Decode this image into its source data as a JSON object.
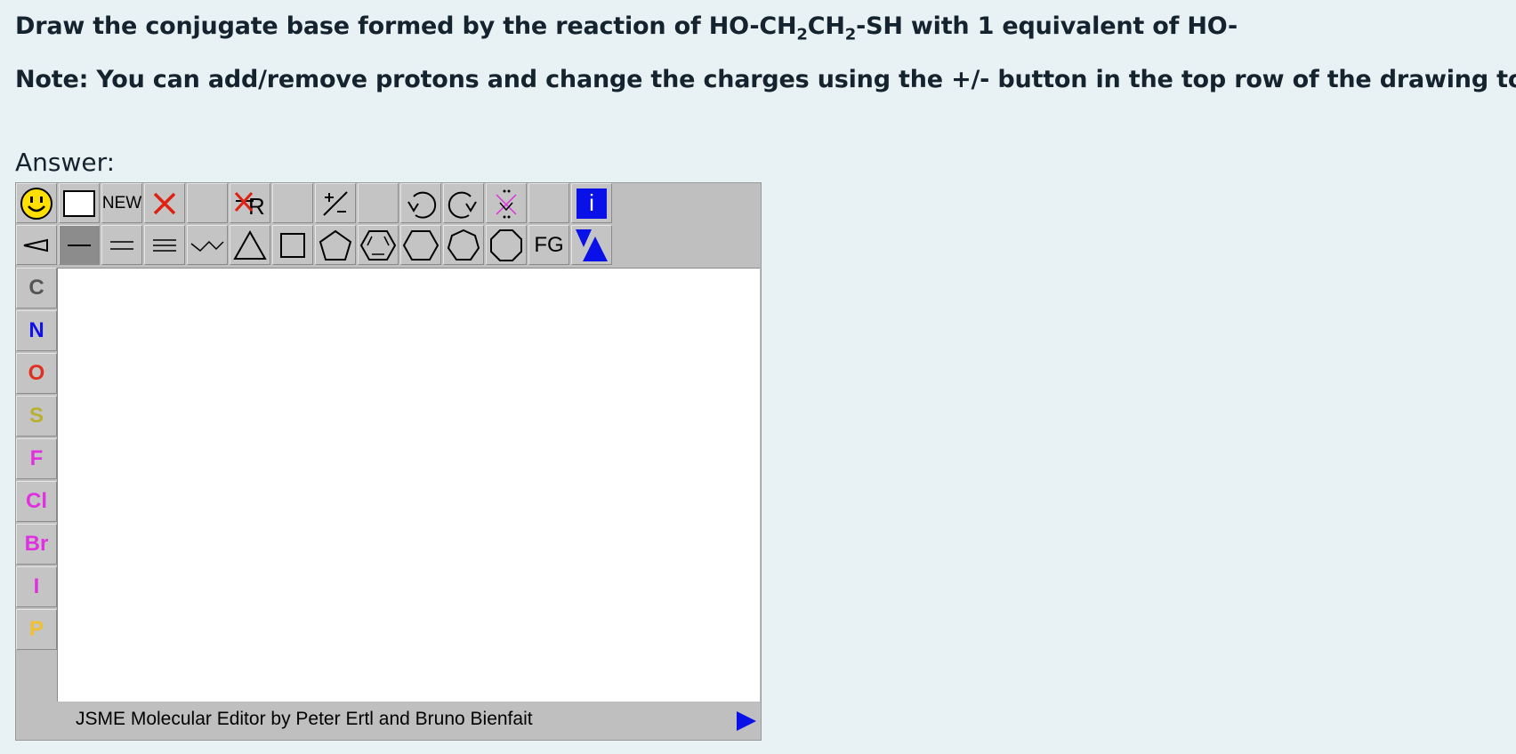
{
  "question": {
    "line1_pre": "Draw the conjugate base formed by the reaction of HO-CH",
    "sub1": "2",
    "mid": "CH",
    "sub2": "2",
    "line1_post": "-SH with 1 equivalent of HO-",
    "line2": "Note: You can add/remove protons and change the charges using the +/- button in the top row of the drawing tool"
  },
  "answer_label": "Answer:",
  "editor": {
    "new_label": "NEW",
    "fg_label": "FG",
    "info_label": "i",
    "credit": "JSME Molecular Editor by Peter Ertl and Bruno Bienfait",
    "elements": [
      {
        "symbol": "C",
        "color": "#555555"
      },
      {
        "symbol": "N",
        "color": "#1010e8"
      },
      {
        "symbol": "O",
        "color": "#e03020"
      },
      {
        "symbol": "S",
        "color": "#b8b030"
      },
      {
        "symbol": "F",
        "color": "#e030e0"
      },
      {
        "symbol": "Cl",
        "color": "#e030e0"
      },
      {
        "symbol": "Br",
        "color": "#e030e0"
      },
      {
        "symbol": "I",
        "color": "#e030e0"
      },
      {
        "symbol": "P",
        "color": "#f0c030"
      }
    ]
  }
}
